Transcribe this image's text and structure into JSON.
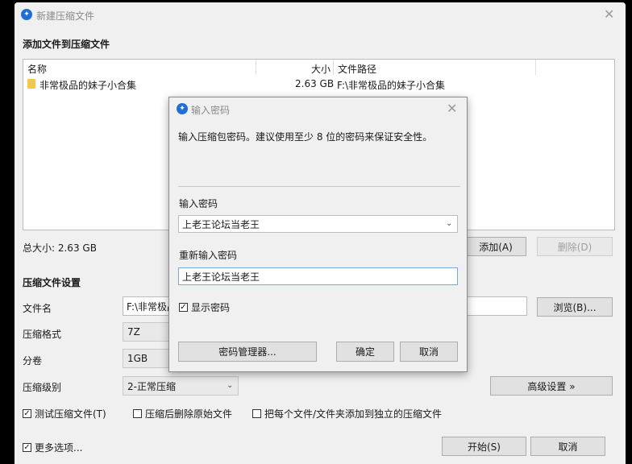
{
  "window": {
    "title": "新建压缩文件",
    "section_add": "添加文件到压缩文件",
    "columns": {
      "name": "名称",
      "size": "大小",
      "path": "文件路径"
    },
    "files": [
      {
        "name": "非常极品的妹子小合集",
        "size": "2.63 GB",
        "path": "F:\\非常极品的妹子小合集",
        "icon": "folder-icon"
      }
    ],
    "total_size": "总大小: 2.63 GB",
    "add_button": "添加(A)",
    "delete_button": "删除(D)",
    "settings_header": "压缩文件设置",
    "filename_label": "文件名",
    "filename_value": "F:\\非常极品",
    "browse_button": "浏览(B)...",
    "format_label": "压缩格式",
    "format_value": "7Z",
    "volume_label": "分卷",
    "volume_value": "1GB",
    "level_label": "压缩级别",
    "level_value": "2-正常压缩",
    "advanced_button": "高级设置 »",
    "options": [
      {
        "label": "测试压缩文件(T)",
        "checked": true
      },
      {
        "label": "压缩后删除原始文件",
        "checked": false
      },
      {
        "label": "把每个文件/文件夹添加到独立的压缩文件",
        "checked": false
      }
    ],
    "more_options": "更多选项...",
    "more_options_checked": true,
    "start_button": "开始(S)",
    "cancel_button": "取消"
  },
  "dialog": {
    "title": "输入密码",
    "description": "输入压缩包密码。建议使用至少 8 位的密码来保证安全性。",
    "password_label": "输入密码",
    "password_value": "上老王论坛当老王",
    "reenter_label": "重新输入密码",
    "reenter_value": "上老王论坛当老王",
    "show_password": "显示密码",
    "show_password_checked": true,
    "manager_button": "密码管理器...",
    "ok_button": "确定",
    "cancel_button": "取消"
  },
  "colors": {
    "accent": "#1f6fd6",
    "window_bg": "#f0f0f0",
    "backdrop": "#000000"
  }
}
